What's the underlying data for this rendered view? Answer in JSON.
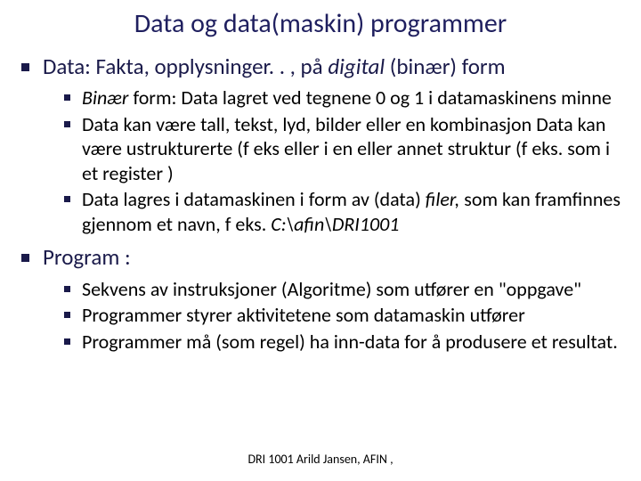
{
  "title": "Data  og data(maskin) programmer",
  "sections": [
    {
      "heading_pre": "Data:  Fakta, opplysninger. . , på ",
      "heading_ital": "digital",
      "heading_post": " (binær) form",
      "items": [
        {
          "ital_lead": "Binær",
          "rest": " form: Data lagret ved tegnene 0 og 1 i datamaskinens minne"
        },
        {
          "plain": "Data kan være tall, tekst, lyd, bilder eller en kombinasjon Data kan være ustrukturerte (f eks eller i en eller annet struktur (f eks. som i et register )"
        },
        {
          "pre": "Data lagres i datamaskinen i form av (data) ",
          "ital_mid": "filer,",
          "mid": " som kan framfinnes gjennom et navn, f eks. ",
          "ital_tail": "C:\\afin\\DRI1001"
        }
      ]
    },
    {
      "heading_plain": "Program :",
      "items": [
        {
          "plain": "Sekvens av instruksjoner (Algoritme) som utfører en \"oppgave\""
        },
        {
          "plain": "Programmer styrer aktivitetene som datamaskin utfører"
        },
        {
          "plain": "Programmer må (som regel) ha inn-data for å produsere et resultat."
        }
      ]
    }
  ],
  "footer": "DRI 1001  Arild Jansen, AFIN ,"
}
